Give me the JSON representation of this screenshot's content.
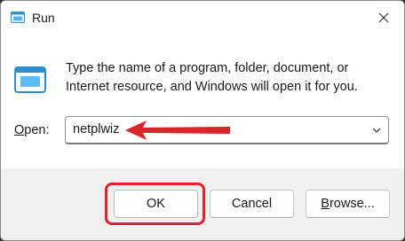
{
  "window": {
    "title": "Run"
  },
  "description": "Type the name of a program, folder, document, or Internet resource, and Windows will open it for you.",
  "open_field": {
    "label_prefix": "",
    "label_accel": "O",
    "label_rest": "pen:",
    "value": "netplwiz"
  },
  "buttons": {
    "ok": "OK",
    "cancel": "Cancel",
    "browse_accel": "B",
    "browse_rest": "rowse..."
  },
  "annotations": {
    "arrow_color": "#d9252b",
    "highlight_color": "#d9252b"
  }
}
